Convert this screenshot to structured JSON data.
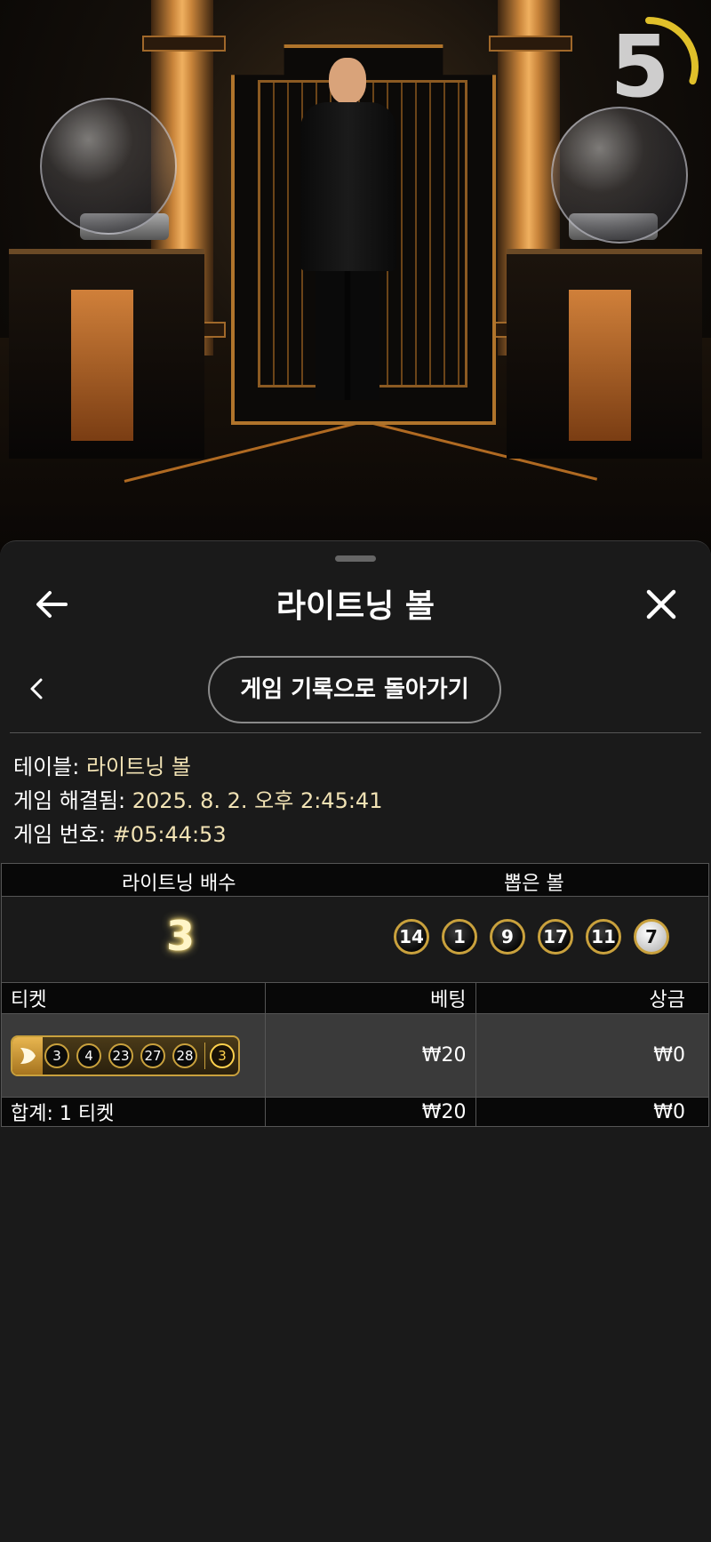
{
  "timer": {
    "value": "5",
    "progress": 0.3
  },
  "header": {
    "title": "라이트닝 볼",
    "back_icon": "arrow-left-icon",
    "close_icon": "close-icon"
  },
  "history_button": {
    "label": "게임 기록으로 돌아가기"
  },
  "info": {
    "table_label": "테이블:",
    "table_value": "라이트닝 볼",
    "resolved_label": "게임 해결됨:",
    "resolved_value": "2025. 8. 2. 오후 2:45:41",
    "number_label": "게임 번호:",
    "number_value": "#05:44:53"
  },
  "draw": {
    "multiplier_label": "라이트닝 배수",
    "balls_label": "뽑은 볼",
    "multiplier": "3",
    "balls": [
      "14",
      "1",
      "9",
      "17",
      "11",
      "7"
    ]
  },
  "tickets": {
    "headers": {
      "ticket": "티켓",
      "bet": "베팅",
      "prize": "상금"
    },
    "rows": [
      {
        "numbers": [
          "3",
          "4",
          "23",
          "27",
          "28"
        ],
        "lightning": "3",
        "bet": "₩20",
        "prize": "₩0"
      }
    ],
    "total": {
      "label": "합계: 1 티켓",
      "bet": "₩20",
      "prize": "₩0"
    }
  },
  "colors": {
    "accent_gold": "#c9a13d",
    "timer_ring": "#e0c02a",
    "sheet_bg": "#1a1a1a"
  }
}
